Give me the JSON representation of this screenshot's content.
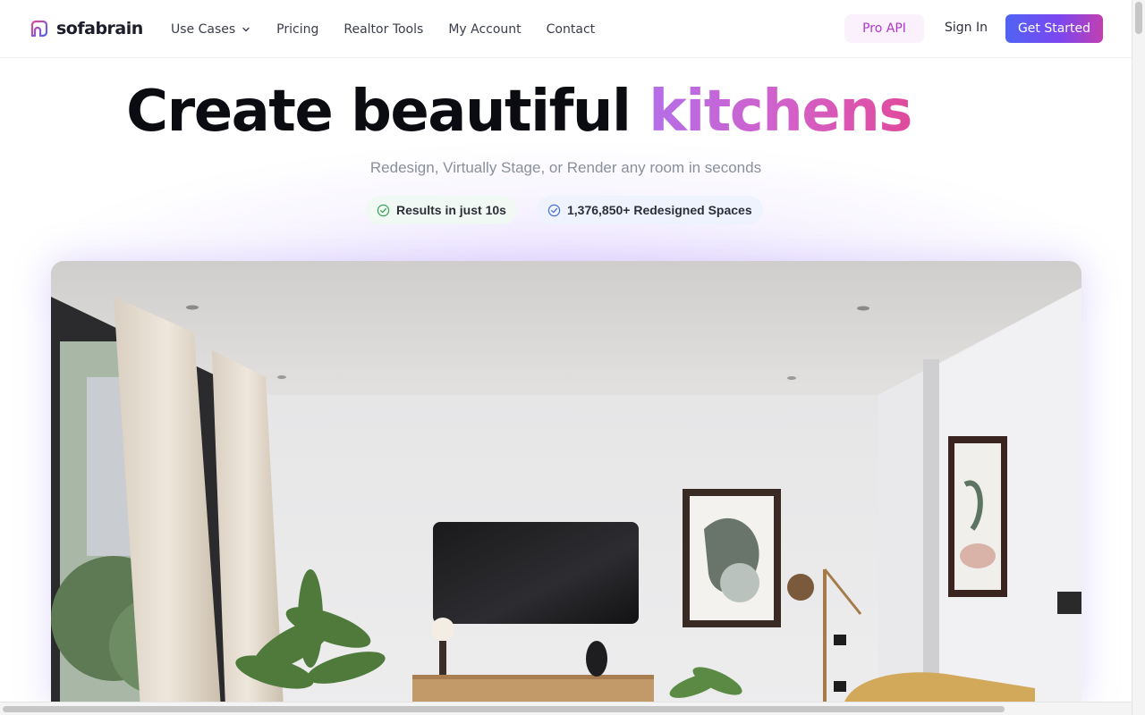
{
  "brand": {
    "name": "sofabrain",
    "accent_start": "#4f63f5",
    "accent_end": "#c13fb0"
  },
  "nav": {
    "links": [
      {
        "label": "Use Cases",
        "has_dropdown": true
      },
      {
        "label": "Pricing"
      },
      {
        "label": "Realtor Tools"
      },
      {
        "label": "My Account"
      },
      {
        "label": "Contact"
      }
    ],
    "pro_api": "Pro API",
    "sign_in": "Sign In",
    "get_started": "Get Started"
  },
  "hero": {
    "headline_main": "Create beautiful",
    "headline_accent": "kitchens",
    "subheadline": "Redesign, Virtually Stage, or Render any room in seconds",
    "badges": [
      {
        "label": "Results in just 10s",
        "color": "#3aa35a"
      },
      {
        "label": "1,376,850+ Redesigned Spaces",
        "color": "#4a6fd8"
      }
    ]
  },
  "image": {
    "subject": "interior-living-room-render"
  }
}
